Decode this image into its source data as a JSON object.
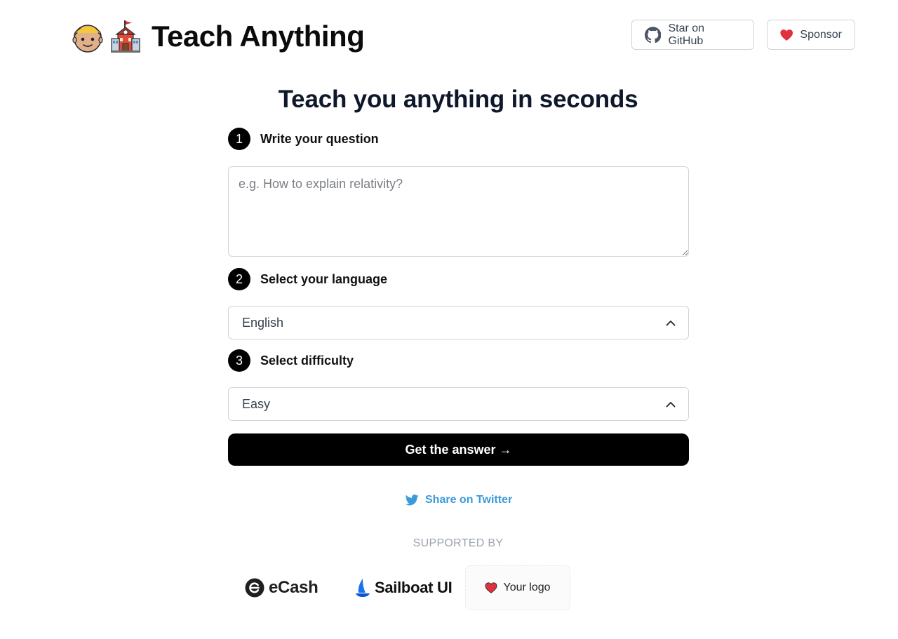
{
  "header": {
    "title": "Teach Anything",
    "github_label": "Star on GitHub",
    "sponsor_label": "Sponsor"
  },
  "main": {
    "headline": "Teach you anything in seconds",
    "steps": [
      {
        "number": "1",
        "label": "Write your question"
      },
      {
        "number": "2",
        "label": "Select your language"
      },
      {
        "number": "3",
        "label": "Select difficulty"
      }
    ],
    "question_placeholder": "e.g. How to explain relativity?",
    "question_value": "",
    "language_value": "English",
    "difficulty_value": "Easy",
    "submit_label": "Get the answer →"
  },
  "footer": {
    "share_label": "Share on Twitter",
    "supported_by": "SUPPORTED BY",
    "sponsors": [
      {
        "name": "eCash"
      },
      {
        "name": "Sailboat UI"
      },
      {
        "name": "Your logo"
      }
    ]
  },
  "colors": {
    "accent_twitter": "#3b9ad9",
    "primary_button": "#000000",
    "heart": "#e0313e"
  },
  "icons": {
    "brand": [
      "person-emoji-icon",
      "school-emoji-icon"
    ],
    "github": "github-icon",
    "sponsor": "heart-icon",
    "select": "chevron-up-icon",
    "share": "twitter-icon"
  }
}
